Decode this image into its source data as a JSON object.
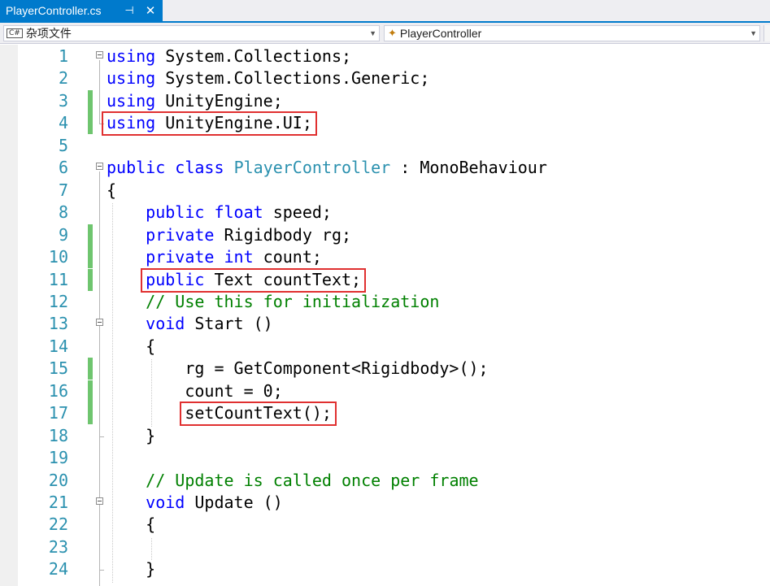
{
  "tab": {
    "title": "PlayerController.cs",
    "pin_glyph": "⊣",
    "close_glyph": "✕"
  },
  "nav": {
    "project_label": "杂项文件",
    "member_label": "PlayerController"
  },
  "colors": {
    "accent": "#007acc",
    "keyword": "#0000ff",
    "type": "#2b91af",
    "comment": "#008000",
    "line_number": "#2b91af",
    "change_marker": "#6fc56f",
    "highlight_box": "#e03030"
  },
  "lines": [
    {
      "n": "1",
      "tokens": [
        {
          "t": "using",
          "c": "kw"
        },
        {
          "t": " System.Collections;"
        }
      ]
    },
    {
      "n": "2",
      "tokens": [
        {
          "t": "using",
          "c": "kw"
        },
        {
          "t": " System.Collections.Generic;"
        }
      ]
    },
    {
      "n": "3",
      "tokens": [
        {
          "t": "using",
          "c": "kw"
        },
        {
          "t": " UnityEngine;"
        }
      ]
    },
    {
      "n": "4",
      "tokens": [
        {
          "t": "using",
          "c": "kw"
        },
        {
          "t": " UnityEngine.UI;"
        }
      ]
    },
    {
      "n": "5",
      "tokens": []
    },
    {
      "n": "6",
      "tokens": [
        {
          "t": "public",
          "c": "kw"
        },
        {
          "t": " "
        },
        {
          "t": "class",
          "c": "kw"
        },
        {
          "t": " "
        },
        {
          "t": "PlayerController",
          "c": "ty"
        },
        {
          "t": " : MonoBehaviour"
        }
      ]
    },
    {
      "n": "7",
      "tokens": [
        {
          "t": "{"
        }
      ]
    },
    {
      "n": "8",
      "tokens": [
        {
          "t": "    "
        },
        {
          "t": "public",
          "c": "kw"
        },
        {
          "t": " "
        },
        {
          "t": "float",
          "c": "kw"
        },
        {
          "t": " speed;"
        }
      ]
    },
    {
      "n": "9",
      "tokens": [
        {
          "t": "    "
        },
        {
          "t": "private",
          "c": "kw"
        },
        {
          "t": " Rigidbody rg;"
        }
      ]
    },
    {
      "n": "10",
      "tokens": [
        {
          "t": "    "
        },
        {
          "t": "private",
          "c": "kw"
        },
        {
          "t": " "
        },
        {
          "t": "int",
          "c": "kw"
        },
        {
          "t": " count;"
        }
      ]
    },
    {
      "n": "11",
      "tokens": [
        {
          "t": "    "
        },
        {
          "t": "public",
          "c": "kw"
        },
        {
          "t": " Text countText;"
        }
      ]
    },
    {
      "n": "12",
      "tokens": [
        {
          "t": "    "
        },
        {
          "t": "// Use this for initialization",
          "c": "cm"
        }
      ]
    },
    {
      "n": "13",
      "tokens": [
        {
          "t": "    "
        },
        {
          "t": "void",
          "c": "kw"
        },
        {
          "t": " Start ()"
        }
      ]
    },
    {
      "n": "14",
      "tokens": [
        {
          "t": "    {"
        }
      ]
    },
    {
      "n": "15",
      "tokens": [
        {
          "t": "        rg = GetComponent<Rigidbody>();"
        }
      ]
    },
    {
      "n": "16",
      "tokens": [
        {
          "t": "        count = 0;"
        }
      ]
    },
    {
      "n": "17",
      "tokens": [
        {
          "t": "        setCountText();"
        }
      ]
    },
    {
      "n": "18",
      "tokens": [
        {
          "t": "    }"
        }
      ]
    },
    {
      "n": "19",
      "tokens": []
    },
    {
      "n": "20",
      "tokens": [
        {
          "t": "    "
        },
        {
          "t": "// Update is called once per frame",
          "c": "cm"
        }
      ]
    },
    {
      "n": "21",
      "tokens": [
        {
          "t": "    "
        },
        {
          "t": "void",
          "c": "kw"
        },
        {
          "t": " Update ()"
        }
      ]
    },
    {
      "n": "22",
      "tokens": [
        {
          "t": "    {"
        }
      ]
    },
    {
      "n": "23",
      "tokens": []
    },
    {
      "n": "24",
      "tokens": [
        {
          "t": "    }"
        }
      ]
    }
  ],
  "changed_lines": [
    "3",
    "4",
    "9",
    "10",
    "11",
    "15",
    "16",
    "17"
  ],
  "folded_lines": [
    "1",
    "6",
    "13",
    "21"
  ],
  "highlighted_lines": [
    "4",
    "11",
    "17"
  ]
}
